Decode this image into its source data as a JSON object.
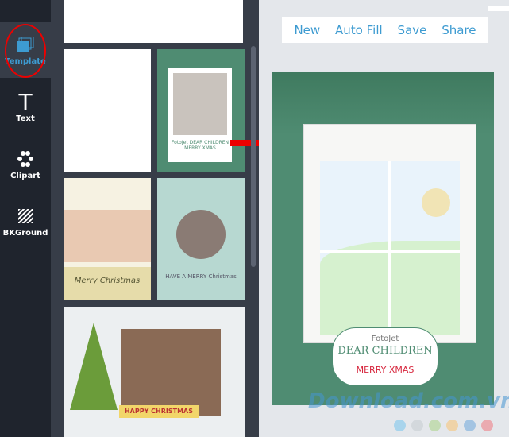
{
  "sidebar": {
    "items": [
      {
        "label": "Template",
        "icon": "template-icon",
        "active": true
      },
      {
        "label": "Text",
        "icon": "text-icon"
      },
      {
        "label": "Clipart",
        "icon": "clipart-icon"
      },
      {
        "label": "BKGround",
        "icon": "background-icon"
      }
    ]
  },
  "templates": [
    {
      "text": "FotoJet DEAR CHILDREN MERRY XMAS"
    },
    {
      "text": "Merry Christmas"
    },
    {
      "text": "HAVE A MERRY Christmas"
    },
    {
      "text": "HAPPY CHRISTMAS"
    }
  ],
  "toolbar": {
    "new": "New",
    "autofill": "Auto Fill",
    "save": "Save",
    "share": "Share"
  },
  "card": {
    "brand": "FotoJet",
    "title": "DEAR CHILDREN",
    "subtitle": "MERRY XMAS"
  },
  "watermark": "Download.com.vn",
  "colors": {
    "accent": "#3d9bd1",
    "card_green": "#4f8c72",
    "swatches": [
      "#a8d4ec",
      "#d3d8dc",
      "#c4dcb4",
      "#efd3a8",
      "#a3c4e2",
      "#eaaab0"
    ]
  }
}
